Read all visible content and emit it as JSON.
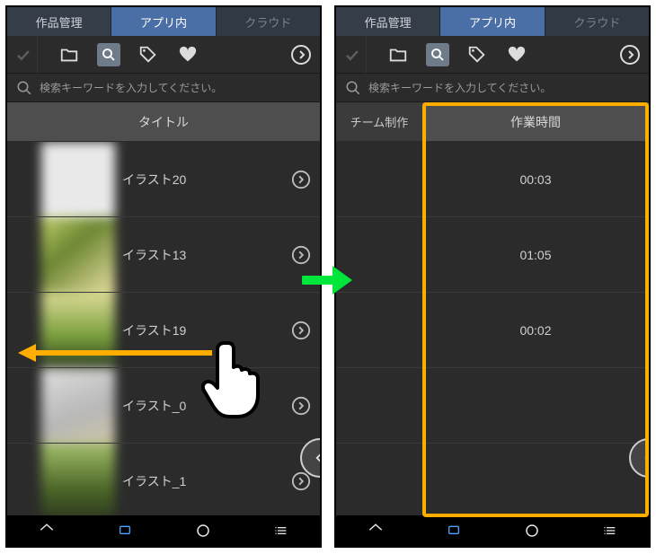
{
  "tabs": {
    "manage": "作品管理",
    "in_app": "アプリ内",
    "cloud": "クラウド"
  },
  "search": {
    "placeholder": "検索キーワードを入力してください。"
  },
  "left": {
    "header": "タイトル",
    "rows": [
      {
        "title": "イラスト20"
      },
      {
        "title": "イラスト13"
      },
      {
        "title": "イラスト19"
      },
      {
        "title": "イラスト_0"
      },
      {
        "title": "イラスト_1"
      }
    ]
  },
  "right": {
    "col_a": "チーム制作",
    "col_b": "作業時間",
    "rows": [
      {
        "time": "00:03"
      },
      {
        "time": "01:05"
      },
      {
        "time": "00:02"
      },
      {
        "time": ""
      },
      {
        "time": ""
      }
    ]
  },
  "colors": {
    "highlight": "#ffae00",
    "transition": "#00e63b",
    "tab_active": "#4a6fa6"
  }
}
